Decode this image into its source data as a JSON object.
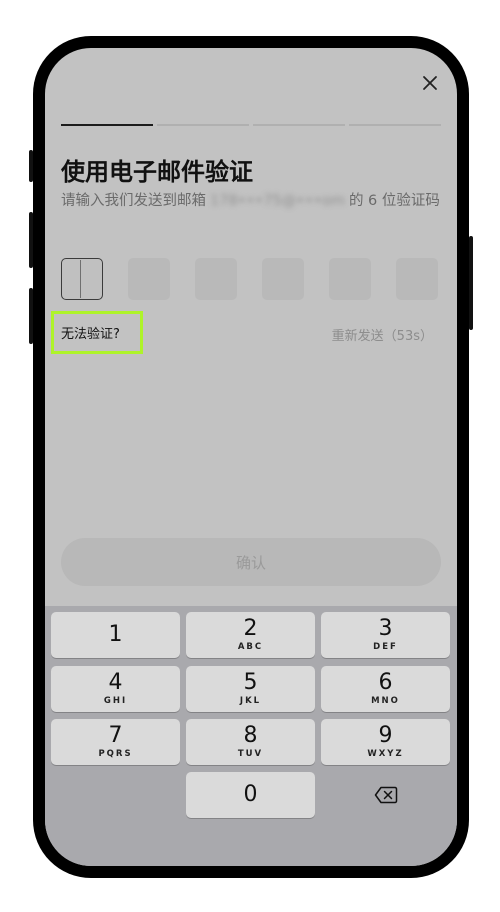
{
  "header": {
    "close_icon": "close-icon"
  },
  "progress": {
    "total_steps": 4,
    "current_step": 1
  },
  "title": "使用电子邮件验证",
  "subtitle": {
    "prefix": "请输入我们发送到邮箱",
    "email_masked": "178•••75@•••om",
    "suffix": "的 6 位验证码"
  },
  "code_input": {
    "length": 6,
    "filled": 0
  },
  "cant_verify": "无法验证?",
  "resend": "重新发送（53s）",
  "confirm_button": "确认",
  "keypad": {
    "keys": [
      {
        "num": "1",
        "letters": ""
      },
      {
        "num": "2",
        "letters": "ABC"
      },
      {
        "num": "3",
        "letters": "DEF"
      },
      {
        "num": "4",
        "letters": "GHI"
      },
      {
        "num": "5",
        "letters": "JKL"
      },
      {
        "num": "6",
        "letters": "MNO"
      },
      {
        "num": "7",
        "letters": "PQRS"
      },
      {
        "num": "8",
        "letters": "TUV"
      },
      {
        "num": "9",
        "letters": "WXYZ"
      },
      {
        "num": "0",
        "letters": ""
      }
    ],
    "delete_icon": "backspace-icon"
  }
}
